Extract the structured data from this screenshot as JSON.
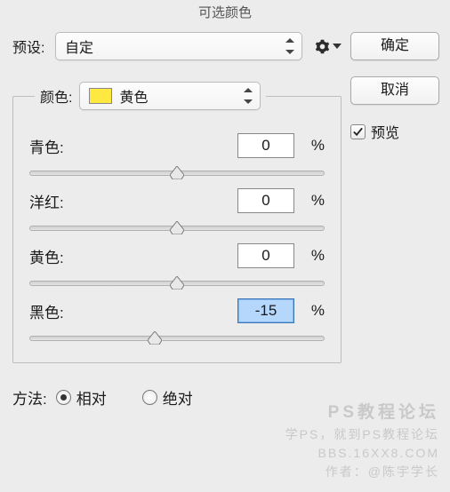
{
  "title": "可选颜色",
  "preset": {
    "label": "预设:",
    "value": "自定"
  },
  "color": {
    "label": "颜色:",
    "value": "黄色",
    "swatch": "#ffe940"
  },
  "sliders": {
    "cyan": {
      "label": "青色:",
      "value": "0",
      "percent": "%",
      "pos": 50
    },
    "magenta": {
      "label": "洋红:",
      "value": "0",
      "percent": "%",
      "pos": 50
    },
    "yellow": {
      "label": "黄色:",
      "value": "0",
      "percent": "%",
      "pos": 50
    },
    "black": {
      "label": "黑色:",
      "value": "-15",
      "percent": "%",
      "pos": 42.5
    }
  },
  "method": {
    "label": "方法:",
    "relative": "相对",
    "absolute": "绝对"
  },
  "buttons": {
    "ok": "确定",
    "cancel": "取消"
  },
  "preview": {
    "label": "预览",
    "checked": true
  },
  "watermark": {
    "l1": "PS教程论坛",
    "l2": "学PS，就到PS教程论坛",
    "l3": "BBS.16XX8.COM",
    "l4": "作者：@陈宇学长"
  }
}
